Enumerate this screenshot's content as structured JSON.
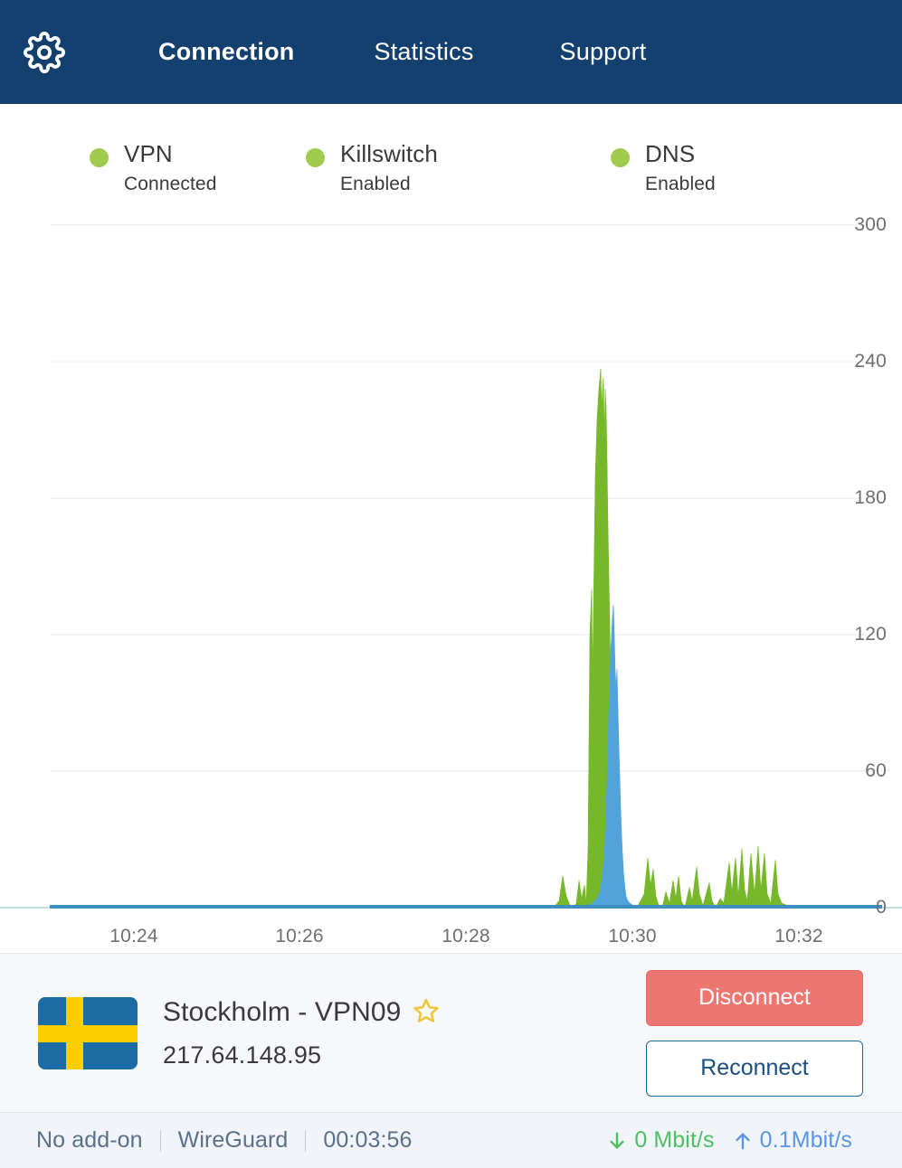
{
  "header": {
    "settings_icon": "gear-icon",
    "tabs": [
      {
        "label": "Connection",
        "active": true
      },
      {
        "label": "Statistics",
        "active": false
      },
      {
        "label": "Support",
        "active": false
      }
    ]
  },
  "status_indicators": [
    {
      "title": "VPN",
      "state": "Connected",
      "color": "#9FCC4E"
    },
    {
      "title": "Killswitch",
      "state": "Enabled",
      "color": "#9FCC4E"
    },
    {
      "title": "DNS",
      "state": "Enabled",
      "color": "#9FCC4E"
    }
  ],
  "chart_data": {
    "type": "area",
    "title": "",
    "xlabel": "",
    "ylabel": "",
    "ylim": [
      0,
      300
    ],
    "yticks": [
      0,
      60,
      120,
      180,
      240,
      300
    ],
    "ytick_labels": [
      "0",
      "60",
      "120",
      "180",
      "240",
      "300"
    ],
    "xtick_labels": [
      "10:24",
      "10:26",
      "10:28",
      "10:30",
      "10:32"
    ],
    "xtick_positions": [
      148,
      331,
      515,
      699,
      883
    ],
    "grid": true,
    "grid_color": "#F0F0F0",
    "legend": "none",
    "series": [
      {
        "name": "download",
        "color": "#76B82A",
        "points": [
          [
            0,
            0
          ],
          [
            200,
            0
          ],
          [
            380,
            0
          ],
          [
            500,
            0
          ],
          [
            560,
            0
          ],
          [
            580,
            0.5
          ],
          [
            595,
            0.3
          ],
          [
            600,
            0
          ],
          [
            612,
            0
          ],
          [
            618,
            3
          ],
          [
            622,
            14
          ],
          [
            626,
            5
          ],
          [
            630,
            1
          ],
          [
            634,
            0
          ],
          [
            637,
            2
          ],
          [
            640,
            12
          ],
          [
            643,
            4
          ],
          [
            646,
            10
          ],
          [
            648,
            2
          ],
          [
            650,
            26
          ],
          [
            652,
            120
          ],
          [
            654,
            140
          ],
          [
            655,
            100
          ],
          [
            656,
            132
          ],
          [
            657,
            160
          ],
          [
            658,
            190
          ],
          [
            660,
            215
          ],
          [
            662,
            228
          ],
          [
            664,
            237
          ],
          [
            665,
            219
          ],
          [
            666,
            228
          ],
          [
            667,
            233
          ],
          [
            668,
            206
          ],
          [
            669,
            228
          ],
          [
            670,
            219
          ],
          [
            671,
            196
          ],
          [
            672,
            168
          ],
          [
            673,
            146
          ],
          [
            674,
            124
          ],
          [
            675,
            104
          ],
          [
            676,
            84
          ],
          [
            677,
            64
          ],
          [
            678,
            46
          ],
          [
            679,
            30
          ],
          [
            680,
            18
          ],
          [
            681,
            9
          ],
          [
            682,
            4
          ],
          [
            683,
            1
          ],
          [
            684,
            0
          ],
          [
            692,
            0
          ],
          [
            700,
            1
          ],
          [
            704,
            0
          ],
          [
            712,
            6
          ],
          [
            716,
            22
          ],
          [
            719,
            10
          ],
          [
            722,
            17
          ],
          [
            725,
            5
          ],
          [
            728,
            1
          ],
          [
            732,
            0
          ],
          [
            736,
            7
          ],
          [
            740,
            2
          ],
          [
            744,
            12
          ],
          [
            747,
            4
          ],
          [
            750,
            14
          ],
          [
            753,
            3
          ],
          [
            757,
            0
          ],
          [
            762,
            9
          ],
          [
            765,
            3
          ],
          [
            770,
            18
          ],
          [
            773,
            6
          ],
          [
            777,
            1
          ],
          [
            784,
            11
          ],
          [
            787,
            3
          ],
          [
            791,
            0
          ],
          [
            796,
            4
          ],
          [
            800,
            2
          ],
          [
            806,
            20
          ],
          [
            809,
            7
          ],
          [
            813,
            22
          ],
          [
            816,
            5
          ],
          [
            820,
            26
          ],
          [
            823,
            8
          ],
          [
            826,
            3
          ],
          [
            830,
            24
          ],
          [
            834,
            6
          ],
          [
            838,
            27
          ],
          [
            841,
            8
          ],
          [
            845,
            24
          ],
          [
            848,
            6
          ],
          [
            852,
            2
          ],
          [
            857,
            21
          ],
          [
            860,
            6
          ],
          [
            864,
            2
          ],
          [
            870,
            1
          ],
          [
            876,
            0
          ],
          [
            900,
            0
          ],
          [
            950,
            0
          ],
          [
            997,
            0
          ]
        ]
      },
      {
        "name": "upload",
        "color": "#52A3DC",
        "points": [
          [
            0,
            0
          ],
          [
            300,
            0
          ],
          [
            500,
            0
          ],
          [
            600,
            0
          ],
          [
            640,
            0
          ],
          [
            650,
            1
          ],
          [
            655,
            2
          ],
          [
            660,
            4
          ],
          [
            664,
            8
          ],
          [
            668,
            22
          ],
          [
            671,
            56
          ],
          [
            673,
            86
          ],
          [
            675,
            112
          ],
          [
            677,
            128
          ],
          [
            678,
            133
          ],
          [
            679,
            120
          ],
          [
            680,
            104
          ],
          [
            681,
            97
          ],
          [
            682,
            105
          ],
          [
            683,
            88
          ],
          [
            684,
            72
          ],
          [
            685,
            58
          ],
          [
            686,
            44
          ],
          [
            687,
            33
          ],
          [
            688,
            24
          ],
          [
            689,
            17
          ],
          [
            690,
            12
          ],
          [
            691,
            8
          ],
          [
            692,
            5
          ],
          [
            694,
            3
          ],
          [
            696,
            2
          ],
          [
            700,
            1
          ],
          [
            710,
            0.5
          ],
          [
            760,
            0.5
          ],
          [
            800,
            0.3
          ],
          [
            860,
            0.3
          ],
          [
            900,
            0
          ],
          [
            997,
            0
          ]
        ]
      }
    ],
    "baseline": {
      "color": "#3D8FBF",
      "width": 4
    },
    "annotations": []
  },
  "connection": {
    "flag": "sweden-flag",
    "server_name": "Stockholm - VPN09",
    "favorite_icon": "star-outline-icon",
    "ip_address": "217.64.148.95",
    "disconnect_label": "Disconnect",
    "reconnect_label": "Reconnect",
    "disconnect_color": "#EE7671",
    "reconnect_border_color": "#1C6BA4"
  },
  "status_bar": {
    "addon": "No add-on",
    "protocol": "WireGuard",
    "duration": "00:03:56",
    "download_icon": "arrow-down-icon",
    "download_speed": "0 Mbit/s",
    "download_color": "#4FBF63",
    "upload_icon": "arrow-up-icon",
    "upload_speed": "0.1Mbit/s",
    "upload_color": "#5B94E8"
  }
}
